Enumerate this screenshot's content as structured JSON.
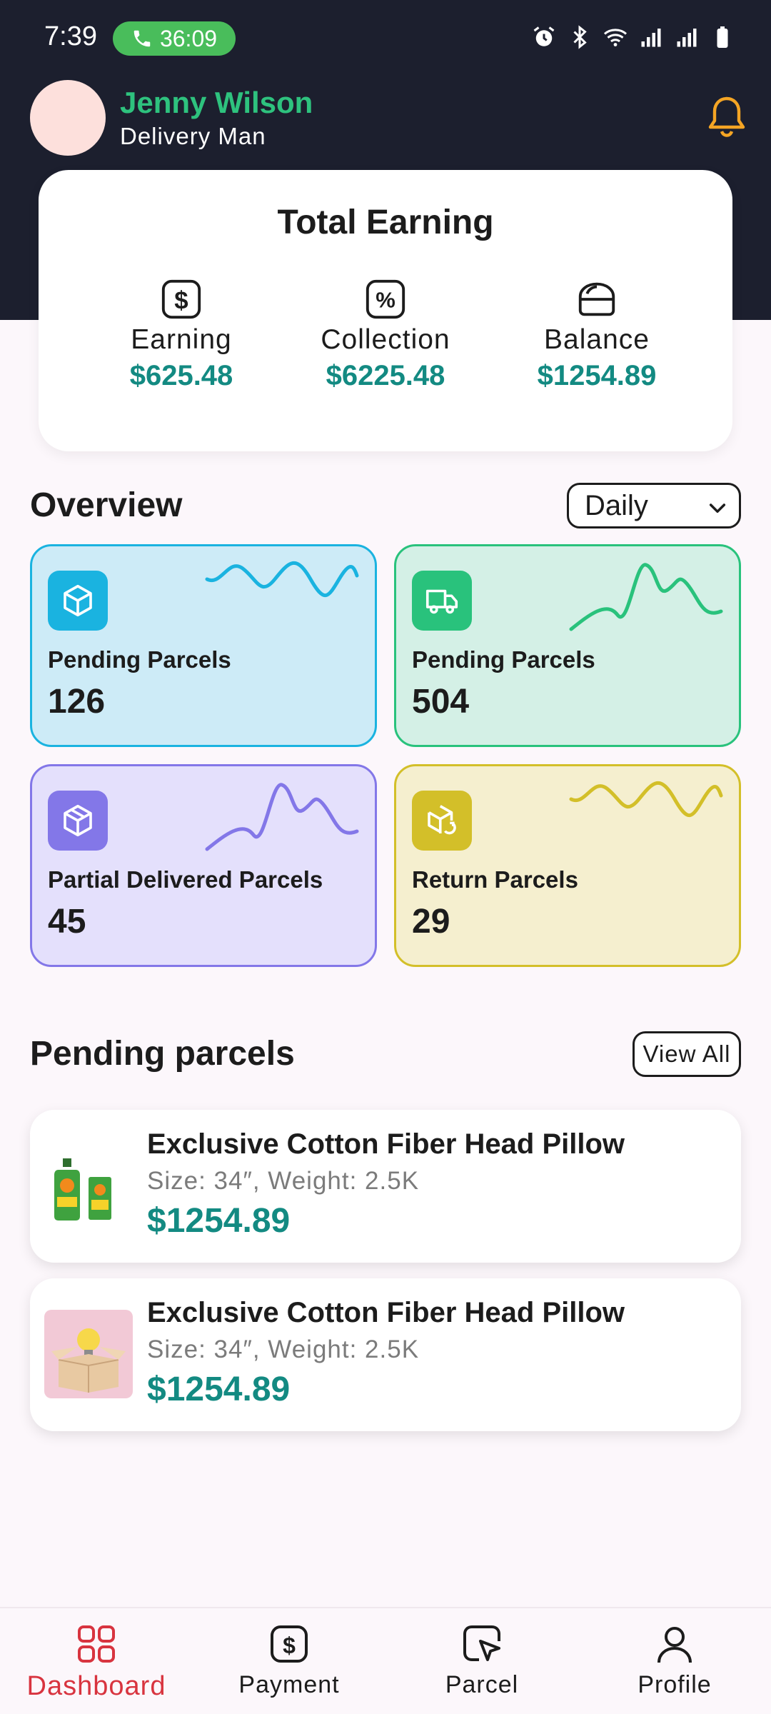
{
  "status_bar": {
    "time": "7:39",
    "call_timer": "36:09"
  },
  "header": {
    "user_name": "Jenny Wilson",
    "user_role": "Delivery Man"
  },
  "earning_card": {
    "title": "Total Earning",
    "items": [
      {
        "icon": "dollar-icon",
        "label": "Earning",
        "value": "$625.48"
      },
      {
        "icon": "percent-icon",
        "label": "Collection",
        "value": "$6225.48"
      },
      {
        "icon": "wallet-icon",
        "label": "Balance",
        "value": "$1254.89"
      }
    ]
  },
  "overview": {
    "title": "Overview",
    "period": "Daily",
    "cards": [
      {
        "icon": "box-icon",
        "label": "Pending Parcels",
        "value": "126",
        "color": "#1ab3e0",
        "bg": "#cdebf7"
      },
      {
        "icon": "truck-icon",
        "label": "Pending Parcels",
        "value": "504",
        "color": "#29c27c",
        "bg": "#d4f0e6"
      },
      {
        "icon": "box-icon",
        "label": "Partial Delivered Parcels",
        "value": "45",
        "color": "#8377e8",
        "bg": "#e4e0fc"
      },
      {
        "icon": "return-box-icon",
        "label": "Return Parcels",
        "value": "29",
        "color": "#d3bf29",
        "bg": "#f5efcf"
      }
    ]
  },
  "pending_parcels": {
    "title": "Pending parcels",
    "view_all": "View All",
    "items": [
      {
        "title": "Exclusive Cotton Fiber Head Pillow",
        "meta": "Size: 34″, Weight: 2.5K",
        "price": "$1254.89"
      },
      {
        "title": "Exclusive Cotton Fiber Head Pillow",
        "meta": "Size: 34″, Weight: 2.5K",
        "price": "$1254.89"
      }
    ]
  },
  "bottom_nav": [
    {
      "icon": "dashboard-icon",
      "label": "Dashboard",
      "active": true
    },
    {
      "icon": "payment-icon",
      "label": "Payment",
      "active": false
    },
    {
      "icon": "parcel-icon",
      "label": "Parcel",
      "active": false
    },
    {
      "icon": "profile-icon",
      "label": "Profile",
      "active": false
    }
  ],
  "colors": {
    "accent": "#138a82",
    "header_bg": "#1c1f2e",
    "name_green": "#2ec27e",
    "active_nav": "#d8343f"
  }
}
